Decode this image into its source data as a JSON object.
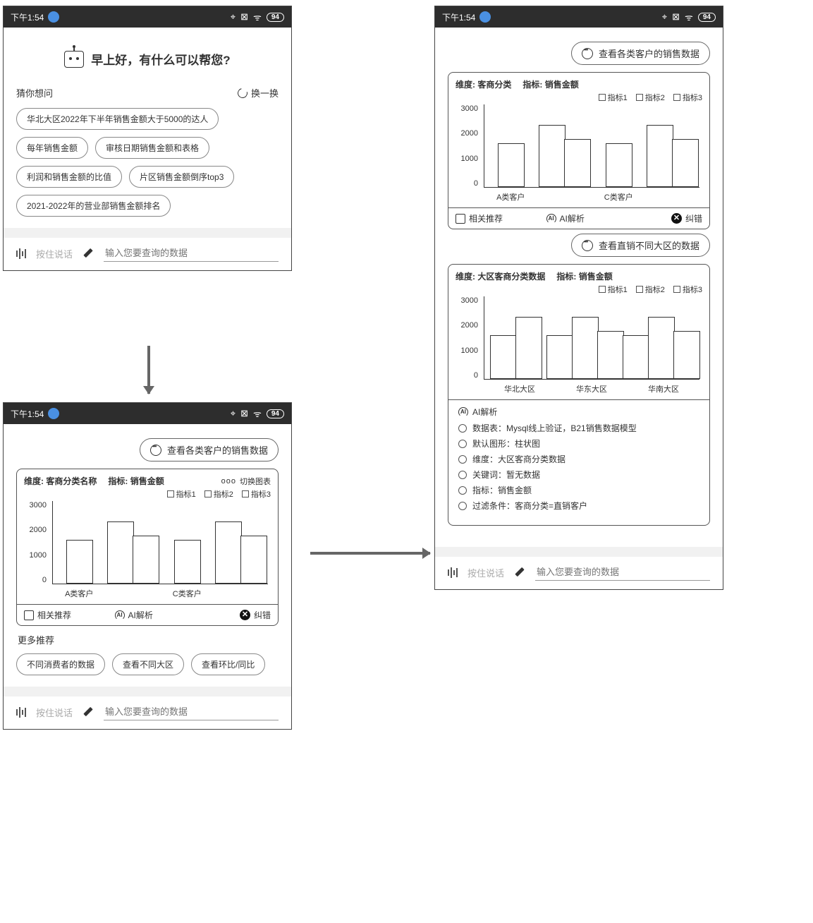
{
  "statusbar": {
    "time": "下午1:54",
    "battery": "94"
  },
  "screenA": {
    "greeting": "早上好，有什么可以帮您?",
    "guess_label": "猜你想问",
    "refresh_label": "换一换",
    "chips": [
      "华北大区2022年下半年销售金额大于5000的达人",
      "每年销售金额",
      "审核日期销售金额和表格",
      "利润和销售金额的比值",
      "片区销售金额倒序top3",
      "2021-2022年的营业部销售金额排名"
    ]
  },
  "input": {
    "voice_hint": "按住说话",
    "placeholder": "输入您要查询的数据"
  },
  "screenB": {
    "bubble": "查看各类客户的销售数据",
    "card": {
      "dim_label": "维度:",
      "dim_value": "客商分类名称",
      "metric_label": "指标:",
      "metric_value": "销售金额",
      "switch": "切换图表"
    },
    "legend": [
      "指标1",
      "指标2",
      "指标3"
    ],
    "actions": {
      "rec": "相关推荐",
      "ai": "AI解析",
      "err": "纠错"
    },
    "more_title": "更多推荐",
    "more_chips": [
      "不同消费者的数据",
      "查看不同大区",
      "查看环比/同比"
    ]
  },
  "screenC": {
    "bubble1": "查看各类客户的销售数据",
    "card1": {
      "dim_label": "维度:",
      "dim_value": "客商分类",
      "metric_label": "指标:",
      "metric_value": "销售金额"
    },
    "bubble2": "查看直销不同大区的数据",
    "card2": {
      "dim_label": "维度:",
      "dim_value": "大区客商分类数据",
      "metric_label": "指标:",
      "metric_value": "销售金额"
    },
    "ai_header": "AI解析",
    "ai_items": [
      "数据表：Mysql线上验证，B21销售数据模型",
      "默认图形：柱状图",
      "维度：大区客商分类数据",
      "关键词：暂无数据",
      "指标：销售金额",
      "过滤条件：客商分类=直销客户"
    ]
  },
  "chart_data": [
    {
      "type": "bar",
      "title": "维度: 客商分类名称  指标: 销售金额",
      "ylabel": "",
      "xlabel": "",
      "ylim": [
        0,
        3000
      ],
      "y_ticks": [
        0,
        1000,
        2000,
        3000
      ],
      "categories": [
        "A类客户",
        "",
        "C类客户",
        ""
      ],
      "series": [
        {
          "name": "指标1",
          "values": [
            1600,
            2250,
            1600,
            2250
          ]
        },
        {
          "name": "指标2",
          "values": [
            null,
            1750,
            null,
            1750
          ]
        }
      ],
      "screen": "B"
    },
    {
      "type": "bar",
      "title": "维度: 客商分类  指标: 销售金额",
      "ylim": [
        0,
        3000
      ],
      "y_ticks": [
        0,
        1000,
        2000,
        3000
      ],
      "categories": [
        "A类客户",
        "",
        "C类客户",
        ""
      ],
      "series": [
        {
          "name": "指标1",
          "values": [
            1600,
            2250,
            1600,
            2250
          ]
        },
        {
          "name": "指标2",
          "values": [
            null,
            1750,
            null,
            1750
          ]
        }
      ],
      "screen": "C-top"
    },
    {
      "type": "bar",
      "title": "维度: 大区客商分类数据  指标: 销售金额",
      "ylim": [
        0,
        3000
      ],
      "y_ticks": [
        0,
        1000,
        2000,
        3000
      ],
      "categories": [
        "华北大区",
        "华东大区",
        "华南大区"
      ],
      "series": [
        {
          "name": "指标1",
          "values": [
            1600,
            1600,
            1600
          ]
        },
        {
          "name": "指标2",
          "values": [
            2250,
            2250,
            2250
          ]
        },
        {
          "name": "指标3",
          "values": [
            null,
            1750,
            1750
          ]
        }
      ],
      "screen": "C-bottom"
    }
  ]
}
